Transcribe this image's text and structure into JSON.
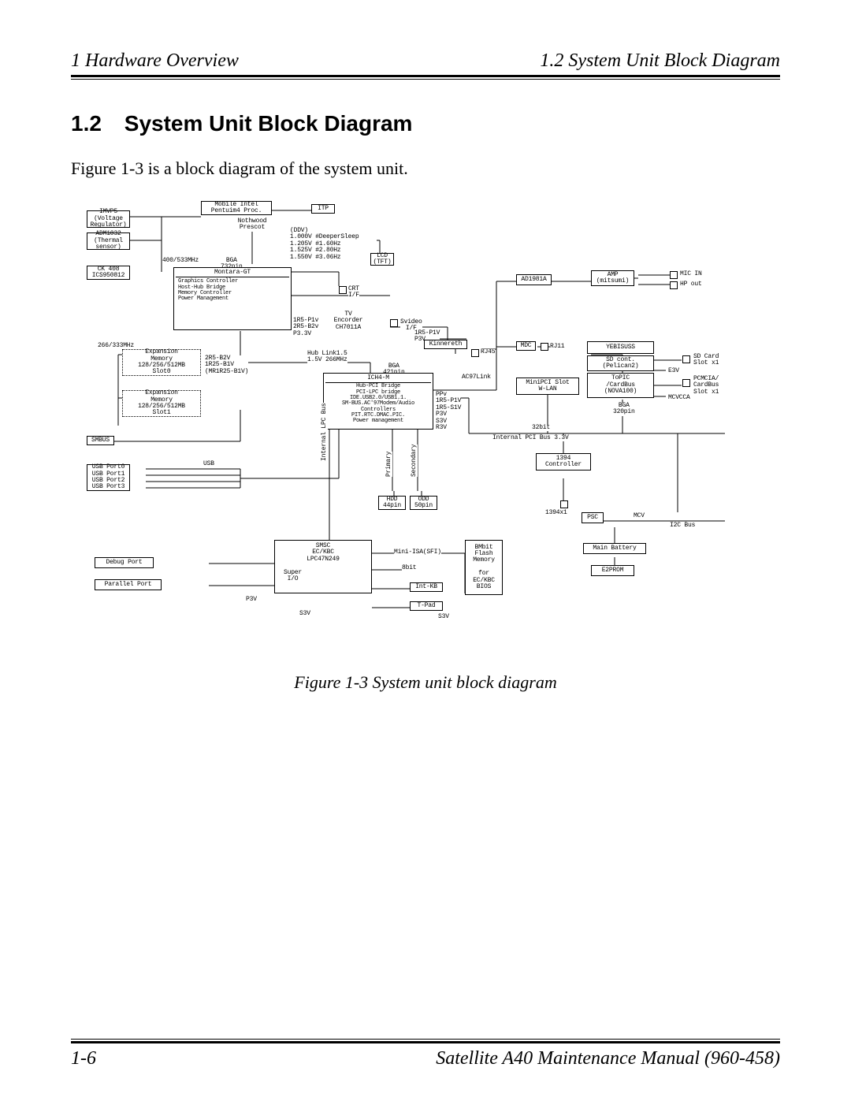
{
  "header": {
    "left": "1  Hardware Overview",
    "right": "1.2 System Unit Block Diagram"
  },
  "section": {
    "number": "1.2",
    "title": "System Unit Block Diagram"
  },
  "intro": "Figure 1-3 is a block diagram of the system unit.",
  "caption": "Figure 1-3  System unit block diagram",
  "footer": {
    "left": "1-6",
    "right": "Satellite A40 Maintenance Manual (960-458)"
  },
  "diagram": {
    "blocks": {
      "imvp5": "IMVP5\n(Voltage\nRegulator)",
      "adm1032": "ADM1032\n(Thermal\nsensor)",
      "ck408": "CK 408\nICS950812",
      "cpu": "Mobile Intel\nPentuim4 Proc.",
      "itp": "ITP",
      "nothwood": "Nothwood\nPrescot",
      "ddv": "(DDV)\n1.000V #DeeperSleep\n1.205V #1.60Hz\n1.525V #2.80Hz\n1.550V #3.06Hz",
      "lcd": "LCD\n(TFT)",
      "montara": "Montara-GT",
      "montara_note": "Graphics Controller\nHost-Hub Bridge\nMemory Controller\nPower Management",
      "bga732": "BGA\n732pin",
      "crt": "CRT\nI/F",
      "tv": "TV\nEncorder\nCH7011A",
      "svideo": "Svideo\nI/F",
      "ad1981a": "AD1981A",
      "amp": "AMP\n(mitsumi)",
      "mic_in": "MIC IN",
      "hp_out": "HP out",
      "mdc": "MDC",
      "rj11": "RJ11",
      "yebisuss": "YEBISUSS",
      "sdcont": "SD cont.\n(Pelican2)",
      "sdcard": "SD Card\nSlot x1",
      "e3v": "E3V",
      "minipci": "MiniPCI Slot\nW-LAN",
      "topic": "ToPIC\n/CardBus\n(NOVA100)",
      "pcmcia": "PCMCIA/\nCardBus\nSlot x1",
      "mcvcca": "MCVCCA",
      "bga320": "BGA\n320pin",
      "bus32": "32bit",
      "pci33": "Internal PCI Bus 3.3V",
      "ich4m": "ICH4-M",
      "ich4m_note": "Hub-PCI Bridge\nPCI-LPC bridge\nIDE.USB2.0/USB1.1.\nSM-BUS.AC'97Modem/Audio\nControllers\nPIT.RTC.DMAC.PIC.\nPower management",
      "hublink": "Hub Link1.5\n1.5V 266MHz",
      "kinnereth": "Kinnereth",
      "rj45": "RJ45",
      "ac97": "AC97Link",
      "bga421": "BGA\n421pin",
      "ppv": "PPv\n1R5-P1V\n1R5-S1V\nP3V\nS3V\nR3V",
      "t_1r5": "1R5-P1v\n2R5-B2v\nP3.3V",
      "tv_1r5": "1R5-P1V\nP3V",
      "bus266": "266/333MHz",
      "bus400": "400/533MHz",
      "exp0": "Expansion\nMemory\n128/256/512MB\nSlot0",
      "exp0_note": "2R5-B2V\n1R25-B1V\n(MR1R25-B1V)",
      "exp1": "Expansion\nMemory\n128/256/512MB\nSlot1",
      "smbus": "SMBUS",
      "usb": "USB",
      "usbports": "USB Port0\nUSB Port1\nUSB Port2\nUSB Port3",
      "hdd": "HDD\n44pin",
      "odd": "ODD\n50pin",
      "lpcbus": "Internal LPC Bus",
      "primary": "Primary",
      "secondary": "Secondary",
      "ctrl1394": "1394\nController",
      "x1394": "1394x1",
      "psc": "PSC",
      "mcv": "MCV",
      "i2c": "I2C Bus",
      "smsc": "SMSC\nEC/KBC\nLPC47N249",
      "superio": "Super\nI/O",
      "miniisa": "Mini-ISA(SFI)",
      "b8": "8bit",
      "intkb": "Int-KB",
      "tpad": "T-Pad",
      "bmbit": "BMbit\nFlash\nMemory\n\nfor\nEC/KBC\nBIOS",
      "mainbat": "Main Battery",
      "e2prom": "E2PROM",
      "debug": "Debug  Port",
      "parallel": "Parallel Port",
      "p3v": "P3V",
      "s3v": "S3V",
      "s3v2": "S3V"
    }
  }
}
